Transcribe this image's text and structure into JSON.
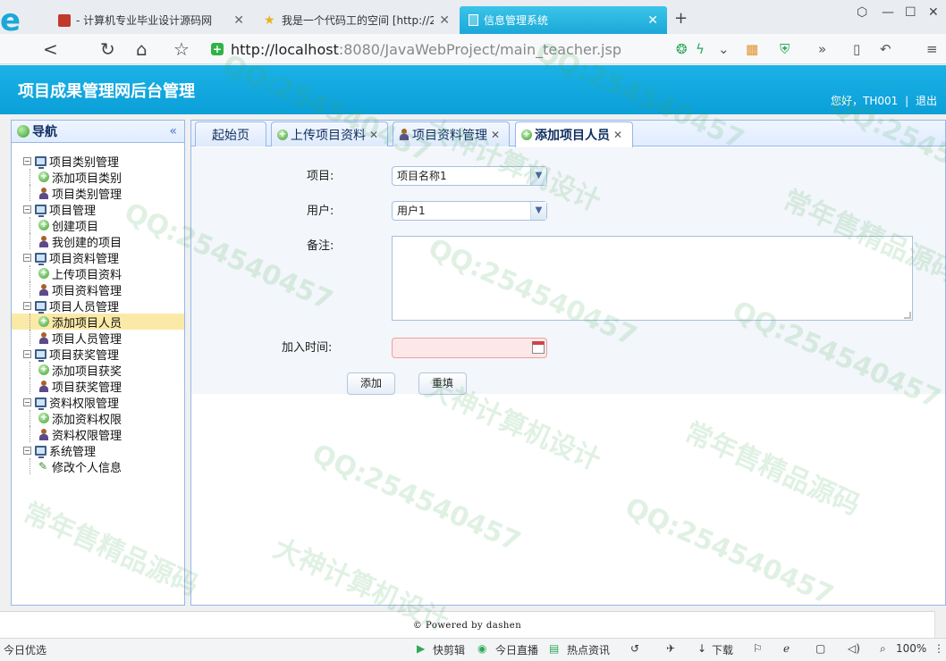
{
  "browser": {
    "tabs": [
      {
        "title": "- 计算机专业毕业设计源码网"
      },
      {
        "title": "我是一个代码工的空间 [http://2"
      },
      {
        "title": "信息管理系统"
      }
    ],
    "url_host": "http://localhost",
    "url_path": ":8080/JavaWebProject/main_teacher.jsp"
  },
  "header": {
    "title": "项目成果管理网后台管理",
    "greeting": "您好，TH001",
    "separator": "|",
    "logout": "退出"
  },
  "nav": {
    "title": "导航",
    "groups": [
      {
        "label": "项目类别管理",
        "items": [
          {
            "label": "添加项目类别",
            "icon": "plus-icon"
          },
          {
            "label": "项目类别管理",
            "icon": "user-icon"
          }
        ]
      },
      {
        "label": "项目管理",
        "items": [
          {
            "label": "创建项目",
            "icon": "plus-icon"
          },
          {
            "label": "我创建的项目",
            "icon": "user-icon"
          }
        ]
      },
      {
        "label": "项目资料管理",
        "items": [
          {
            "label": "上传项目资料",
            "icon": "plus-icon"
          },
          {
            "label": "项目资料管理",
            "icon": "user-icon"
          }
        ]
      },
      {
        "label": "项目人员管理",
        "items": [
          {
            "label": "添加项目人员",
            "icon": "plus-icon",
            "selected": true
          },
          {
            "label": "项目人员管理",
            "icon": "user-icon"
          }
        ]
      },
      {
        "label": "项目获奖管理",
        "items": [
          {
            "label": "添加项目获奖",
            "icon": "plus-icon"
          },
          {
            "label": "项目获奖管理",
            "icon": "user-icon"
          }
        ]
      },
      {
        "label": "资料权限管理",
        "items": [
          {
            "label": "添加资料权限",
            "icon": "plus-icon"
          },
          {
            "label": "资料权限管理",
            "icon": "user-icon"
          }
        ]
      },
      {
        "label": "系统管理",
        "items": [
          {
            "label": "修改个人信息",
            "icon": "pencil-icon"
          }
        ]
      }
    ]
  },
  "content_tabs": [
    {
      "label": "起始页",
      "closable": false,
      "icon": ""
    },
    {
      "label": "上传项目资料",
      "closable": true,
      "icon": "plus-icon"
    },
    {
      "label": "项目资料管理",
      "closable": true,
      "icon": "user-icon"
    },
    {
      "label": "添加项目人员",
      "closable": true,
      "icon": "plus-icon",
      "active": true
    }
  ],
  "form": {
    "project_label": "项目:",
    "project_value": "项目名称1",
    "user_label": "用户:",
    "user_value": "用户1",
    "remark_label": "备注:",
    "join_time_label": "加入时间:",
    "add_button": "添加",
    "reset_button": "重填"
  },
  "footer": {
    "text": "Powered by dashen"
  },
  "statusbar": {
    "left": "今日优选",
    "items": [
      "快剪辑",
      "今日直播",
      "热点资讯",
      "下载"
    ],
    "zoom": "100%"
  },
  "watermark": {
    "texts": [
      "QQ:254540457",
      "大神计算机设计",
      "常年售精品源码"
    ]
  },
  "colors": {
    "header_bg": "#0ba6dc",
    "active_browser_tab": "#1aa8d8",
    "selected_nav": "#fbe9a8",
    "panel_border": "#95b8e7"
  }
}
